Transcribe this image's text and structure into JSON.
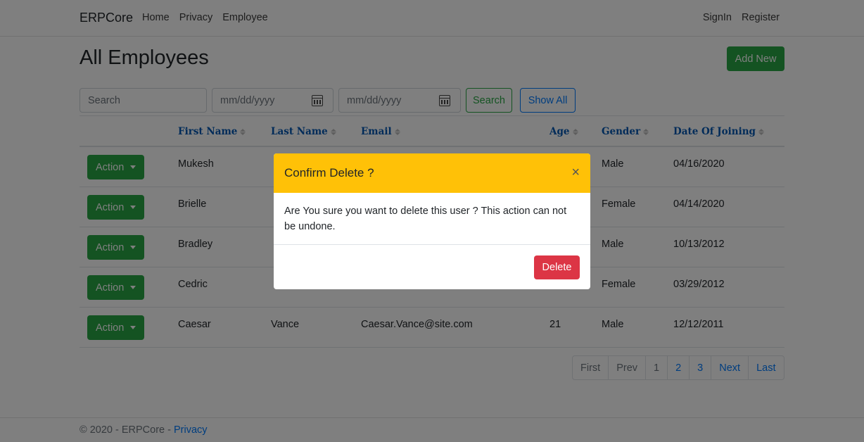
{
  "navbar": {
    "brand": "ERPCore",
    "links": [
      "Home",
      "Privacy",
      "Employee"
    ],
    "right_links": [
      "SignIn",
      "Register"
    ]
  },
  "page": {
    "title": "All Employees",
    "add_new_label": "Add New"
  },
  "filters": {
    "search_placeholder": "Search",
    "date_from_placeholder": "mm/dd/yyyy",
    "date_to_placeholder": "mm/dd/yyyy",
    "search_button": "Search",
    "show_all_button": "Show All"
  },
  "table": {
    "headers": [
      "First Name",
      "Last Name",
      "Email",
      "Age",
      "Gender",
      "Date Of Joining"
    ],
    "action_label": "Action",
    "rows": [
      {
        "first_name": "Mukesh",
        "last_name": "",
        "email": "",
        "age": "",
        "gender": "Male",
        "date_of_joining": "04/16/2020"
      },
      {
        "first_name": "Brielle",
        "last_name": "",
        "email": "",
        "age": "",
        "gender": "Female",
        "date_of_joining": "04/14/2020"
      },
      {
        "first_name": "Bradley",
        "last_name": "",
        "email": "",
        "age": "",
        "gender": "Male",
        "date_of_joining": "10/13/2012"
      },
      {
        "first_name": "Cedric",
        "last_name": "",
        "email": "",
        "age": "",
        "gender": "Female",
        "date_of_joining": "03/29/2012"
      },
      {
        "first_name": "Caesar",
        "last_name": "Vance",
        "email": "Caesar.Vance@site.com",
        "age": "21",
        "gender": "Male",
        "date_of_joining": "12/12/2011"
      }
    ]
  },
  "pagination": {
    "first": "First",
    "prev": "Prev",
    "pages": [
      "1",
      "2",
      "3"
    ],
    "next": "Next",
    "last": "Last"
  },
  "footer": {
    "text": "© 2020 - ERPCore -",
    "link": "Privacy"
  },
  "modal": {
    "title": "Confirm Delete ?",
    "close_symbol": "×",
    "body": "Are You sure you want to delete this user ? This action can not be undone.",
    "delete_button": "Delete"
  },
  "colors": {
    "success": "#28a745",
    "primary": "#007bff",
    "warning": "#ffc107",
    "danger": "#dc3545"
  },
  "icons": [
    "calendar-icon",
    "sort-icon",
    "caret-down-icon",
    "close-icon"
  ]
}
